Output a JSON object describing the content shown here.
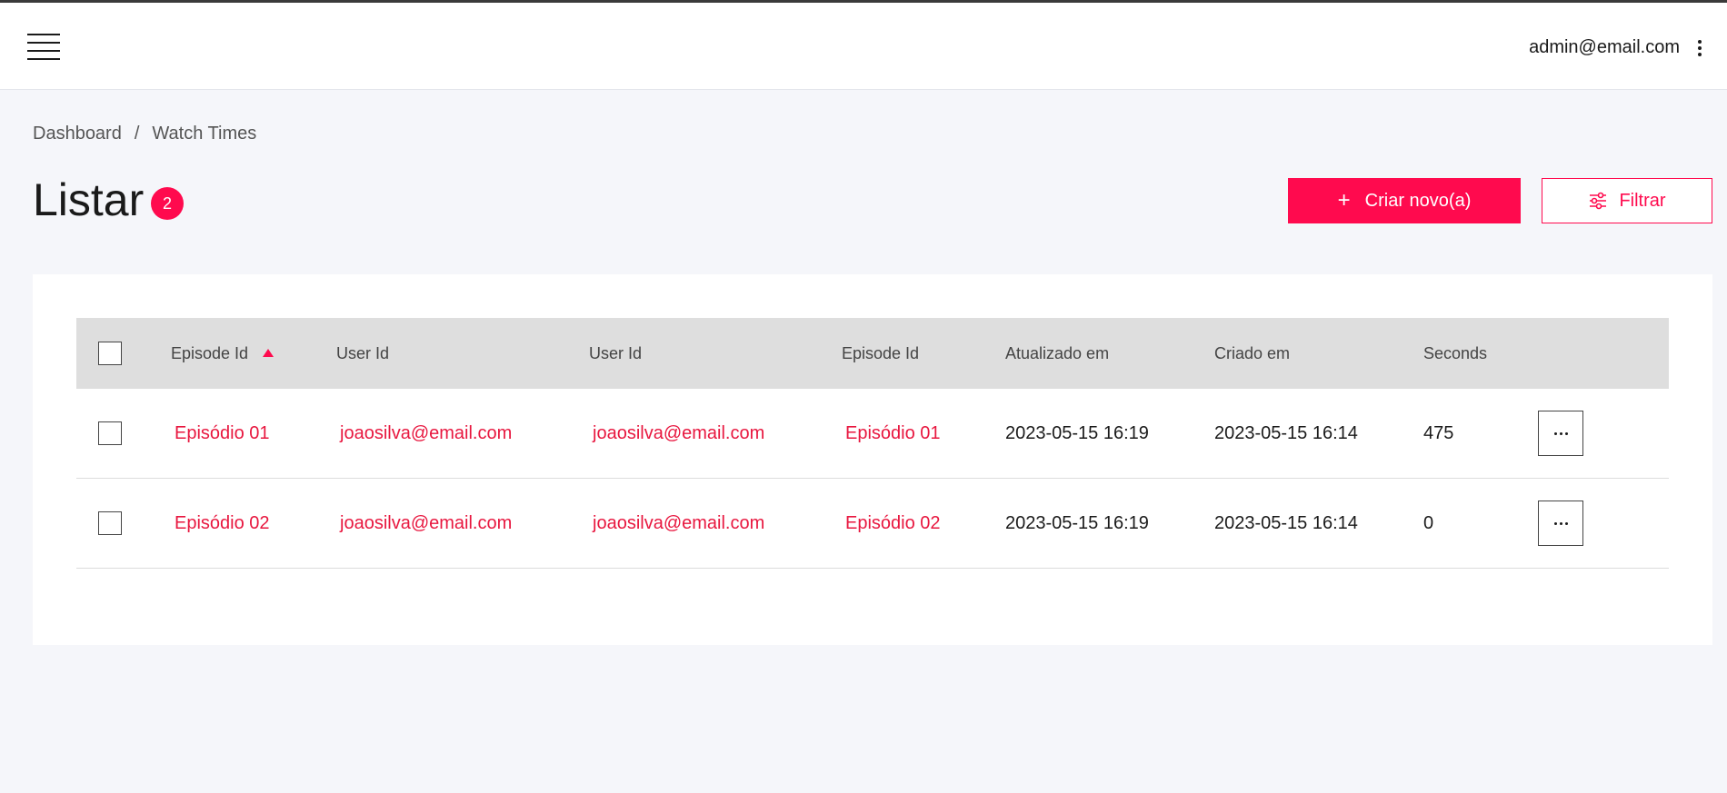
{
  "header": {
    "user_email": "admin@email.com"
  },
  "breadcrumb": {
    "items": [
      "Dashboard",
      "Watch Times"
    ],
    "separator": "/"
  },
  "page": {
    "title": "Listar",
    "count": "2",
    "create_label": "Criar novo(a)",
    "create_icon": "plus-icon",
    "filter_label": "Filtrar",
    "filter_icon": "sliders-icon"
  },
  "colors": {
    "accent": "#ff0a4e",
    "link": "#e8173f",
    "header_bg": "#dedede",
    "page_bg": "#f5f6fa"
  },
  "table": {
    "columns": [
      "Episode Id",
      "User Id",
      "User Id",
      "Episode Id",
      "Atualizado em",
      "Criado em",
      "Seconds"
    ],
    "sorted_column": "Episode Id",
    "sort_direction": "ascending",
    "rows": [
      {
        "episode_id": "Episódio 01",
        "user_id": "joaosilva@email.com",
        "user_id_2": "joaosilva@email.com",
        "episode_id_2": "Episódio 01",
        "updated_at": "2023-05-15 16:19",
        "created_at": "2023-05-15 16:14",
        "seconds": "475"
      },
      {
        "episode_id": "Episódio 02",
        "user_id": "joaosilva@email.com",
        "user_id_2": "joaosilva@email.com",
        "episode_id_2": "Episódio 02",
        "updated_at": "2023-05-15 16:19",
        "created_at": "2023-05-15 16:14",
        "seconds": "0"
      }
    ]
  }
}
